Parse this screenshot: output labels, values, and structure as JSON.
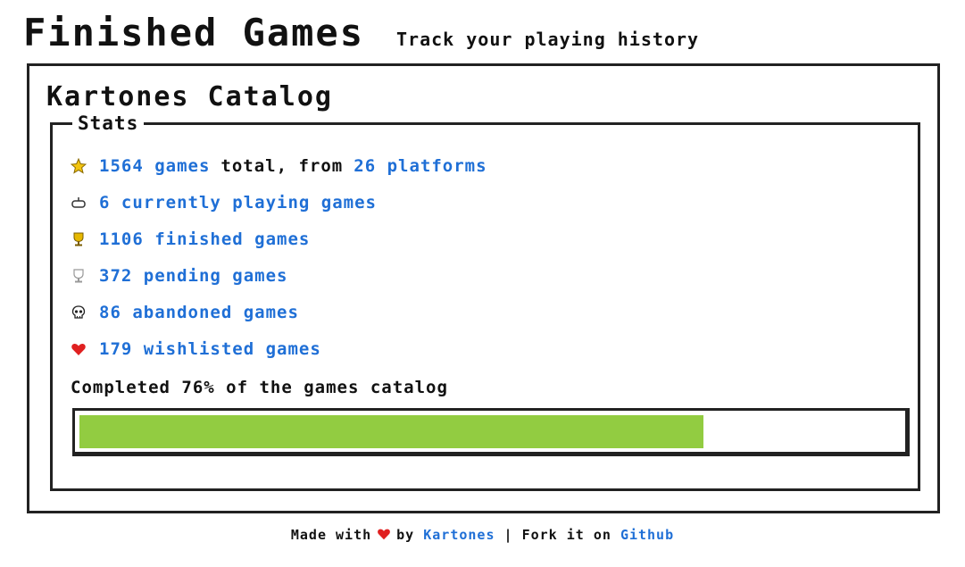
{
  "header": {
    "title": "Finished Games",
    "subtitle": "Track your playing history"
  },
  "catalog": {
    "title": "Kartones Catalog",
    "stats_legend": "Stats",
    "stats": [
      {
        "icon": "star-icon",
        "count": "1564",
        "label": "games",
        "mid": "total, from",
        "count2": "26",
        "label2": "platforms"
      },
      {
        "icon": "gamepad-icon",
        "text": "6 currently playing games"
      },
      {
        "icon": "trophy-icon",
        "text": "1106 finished games"
      },
      {
        "icon": "pending-trophy-icon",
        "text": "372 pending games"
      },
      {
        "icon": "skull-icon",
        "text": "86 abandoned games"
      },
      {
        "icon": "heart-icon",
        "text": "179 wishlisted games"
      }
    ],
    "completion_text": "Completed 76% of the games catalog",
    "completion_percent": 76
  },
  "footer": {
    "made_with": "Made with",
    "by": "by",
    "author": "Kartones",
    "separator": "|",
    "fork_text": "Fork it on",
    "github": "Github"
  },
  "colors": {
    "link": "#1f6fd6",
    "progress": "#92cc41",
    "heart": "#e02020",
    "trophy": "#e6b800",
    "star": "#f2c40f"
  }
}
